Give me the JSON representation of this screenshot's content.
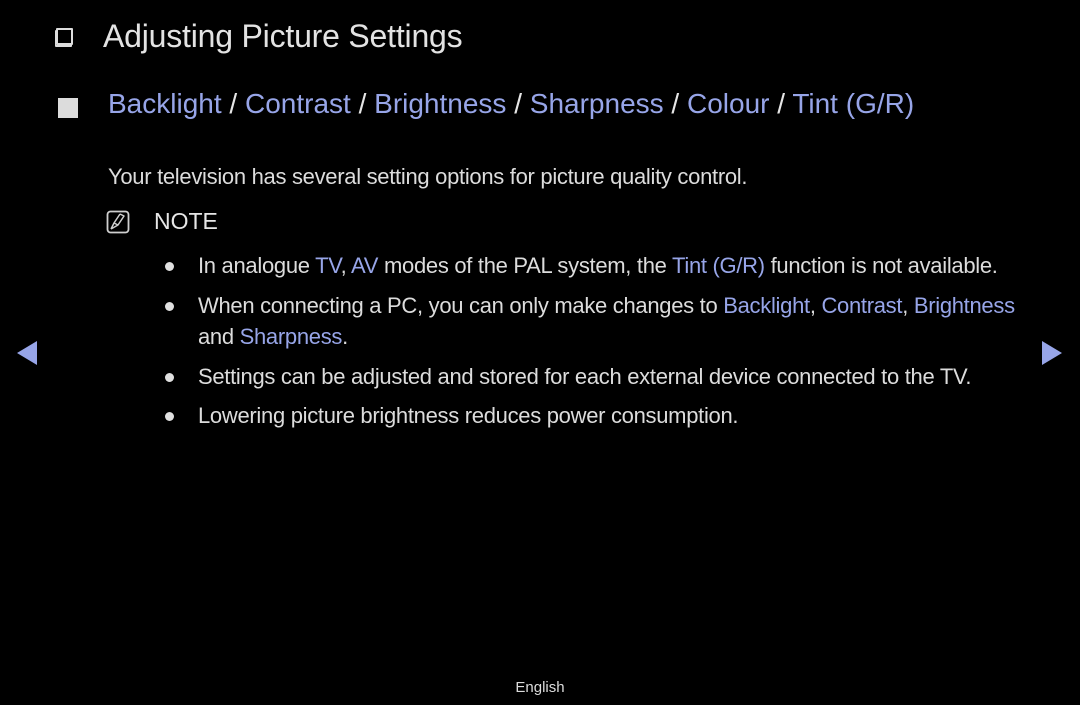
{
  "page_title": "Adjusting Picture Settings",
  "section": {
    "items": [
      "Backlight",
      "Contrast",
      "Brightness",
      "Sharpness",
      "Colour",
      "Tint (G/R)"
    ],
    "separator": " / "
  },
  "intro": "Your television has several setting options for picture quality control.",
  "note": {
    "icon": "note-pencil-icon",
    "label": "NOTE"
  },
  "bullets": [
    {
      "parts": [
        {
          "text": "In analogue ",
          "hl": false
        },
        {
          "text": "TV",
          "hl": true
        },
        {
          "text": ", ",
          "hl": false
        },
        {
          "text": "AV",
          "hl": true
        },
        {
          "text": " modes of the PAL system, the ",
          "hl": false
        },
        {
          "text": "Tint (G/R)",
          "hl": true
        },
        {
          "text": " function is not available.",
          "hl": false
        }
      ]
    },
    {
      "parts": [
        {
          "text": "When connecting a PC, you can only make changes to ",
          "hl": false
        },
        {
          "text": "Backlight",
          "hl": true
        },
        {
          "text": ", ",
          "hl": false
        },
        {
          "text": "Contrast",
          "hl": true
        },
        {
          "text": ", ",
          "hl": false
        },
        {
          "text": "Brightness",
          "hl": true
        },
        {
          "text": " and ",
          "hl": false
        },
        {
          "text": "Sharpness",
          "hl": true
        },
        {
          "text": ".",
          "hl": false
        }
      ]
    },
    {
      "parts": [
        {
          "text": "Settings can be adjusted and stored for each external device connected to the TV.",
          "hl": false
        }
      ]
    },
    {
      "parts": [
        {
          "text": "Lowering picture brightness reduces power consumption.",
          "hl": false
        }
      ]
    }
  ],
  "navigation": {
    "prev_icon": "left-triangle-icon",
    "next_icon": "right-triangle-icon"
  },
  "footer": {
    "language": "English"
  },
  "colors": {
    "highlight": "#97a5e8",
    "background": "#000000",
    "text": "#dcdcdc"
  }
}
